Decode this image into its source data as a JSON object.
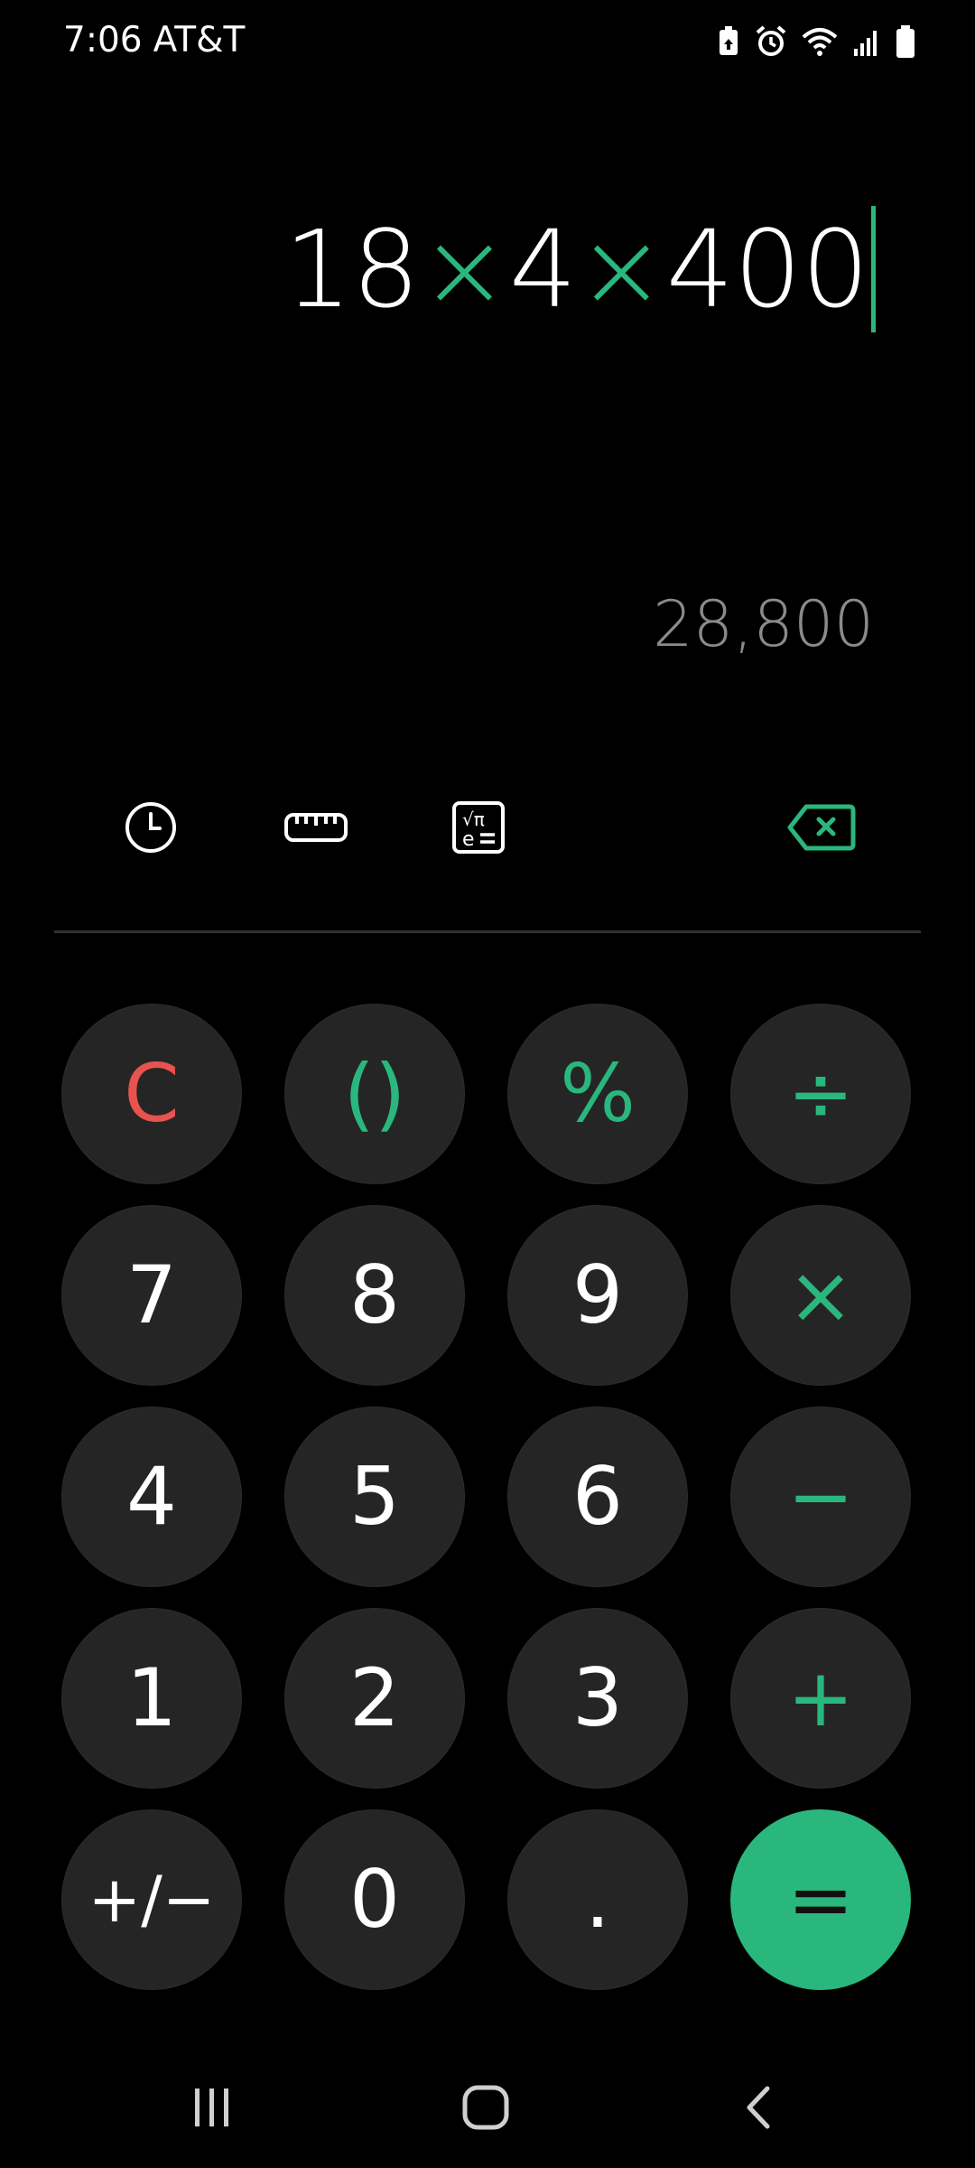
{
  "status_bar": {
    "time": "7:06",
    "carrier": "AT&T",
    "icons": [
      "battery-saver-icon",
      "alarm-icon",
      "wifi-icon",
      "signal-icon",
      "battery-icon"
    ]
  },
  "display": {
    "expression_parts": [
      {
        "text": "18",
        "type": "num"
      },
      {
        "text": "×",
        "type": "op"
      },
      {
        "text": "4",
        "type": "num"
      },
      {
        "text": "×",
        "type": "op"
      },
      {
        "text": "400",
        "type": "num"
      }
    ],
    "result": "28,800"
  },
  "toolbar": {
    "icons": [
      "history-icon",
      "ruler-icon",
      "scientific-icon",
      "backspace-icon"
    ]
  },
  "keypad": {
    "row1": [
      "C",
      "()",
      "%",
      "÷"
    ],
    "row2": [
      "7",
      "8",
      "9",
      "×"
    ],
    "row3": [
      "4",
      "5",
      "6",
      "−"
    ],
    "row4": [
      "1",
      "2",
      "3",
      "+"
    ],
    "row5": [
      "+/−",
      "0",
      ".",
      "="
    ]
  },
  "colors": {
    "accent": "#2ab77d",
    "clear": "#e7534f",
    "key_bg": "#252525",
    "background": "#000000"
  },
  "nav_bar": {
    "icons": [
      "recents-icon",
      "home-icon",
      "back-icon"
    ]
  }
}
